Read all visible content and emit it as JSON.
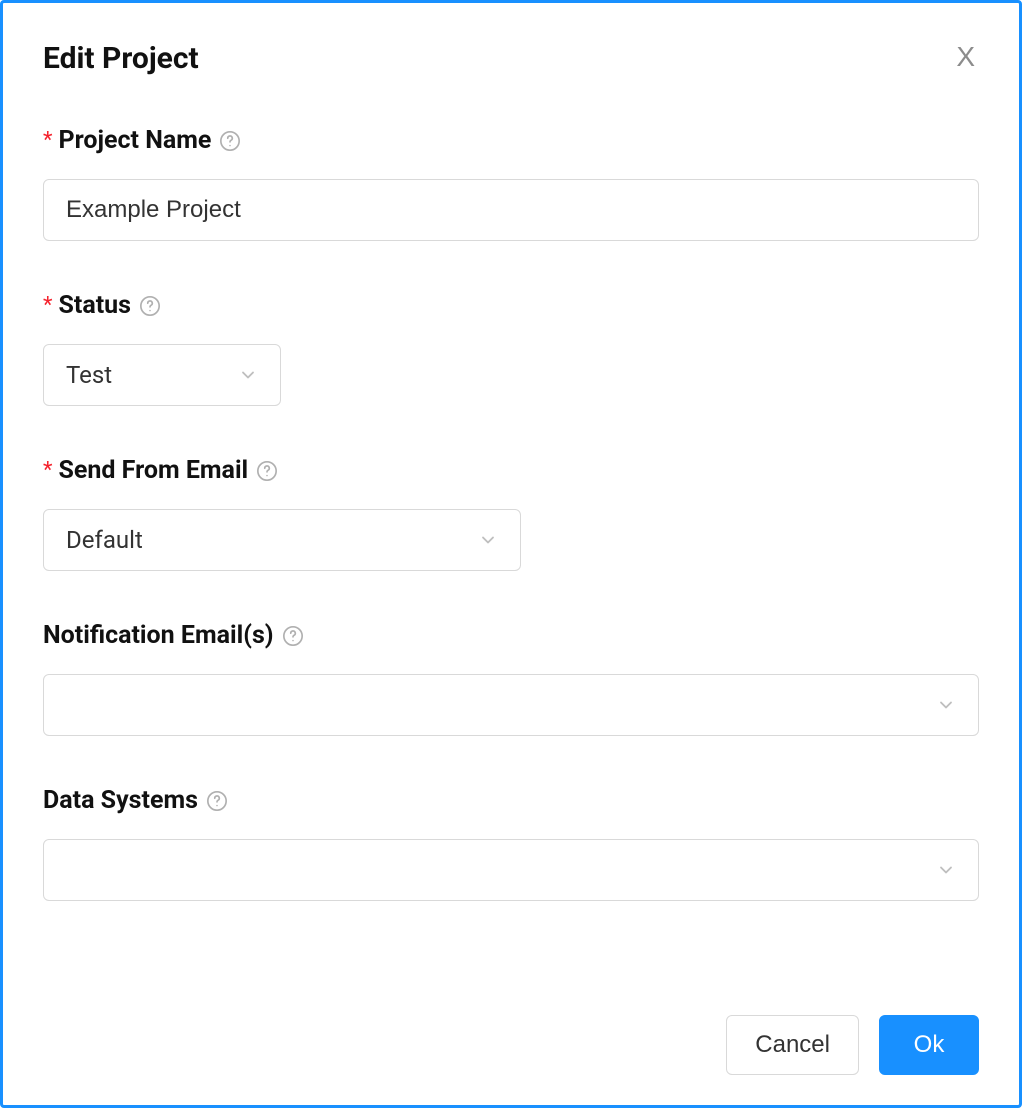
{
  "modal": {
    "title": "Edit Project",
    "close_label": "X"
  },
  "fields": {
    "project_name": {
      "label": "Project Name",
      "required": true,
      "value": "Example Project"
    },
    "status": {
      "label": "Status",
      "required": true,
      "value": "Test"
    },
    "send_from_email": {
      "label": "Send From Email",
      "required": true,
      "value": "Default"
    },
    "notification_emails": {
      "label": "Notification Email(s)",
      "required": false,
      "value": ""
    },
    "data_systems": {
      "label": "Data Systems",
      "required": false,
      "value": ""
    }
  },
  "footer": {
    "cancel_label": "Cancel",
    "ok_label": "Ok"
  },
  "required_marker": "*"
}
